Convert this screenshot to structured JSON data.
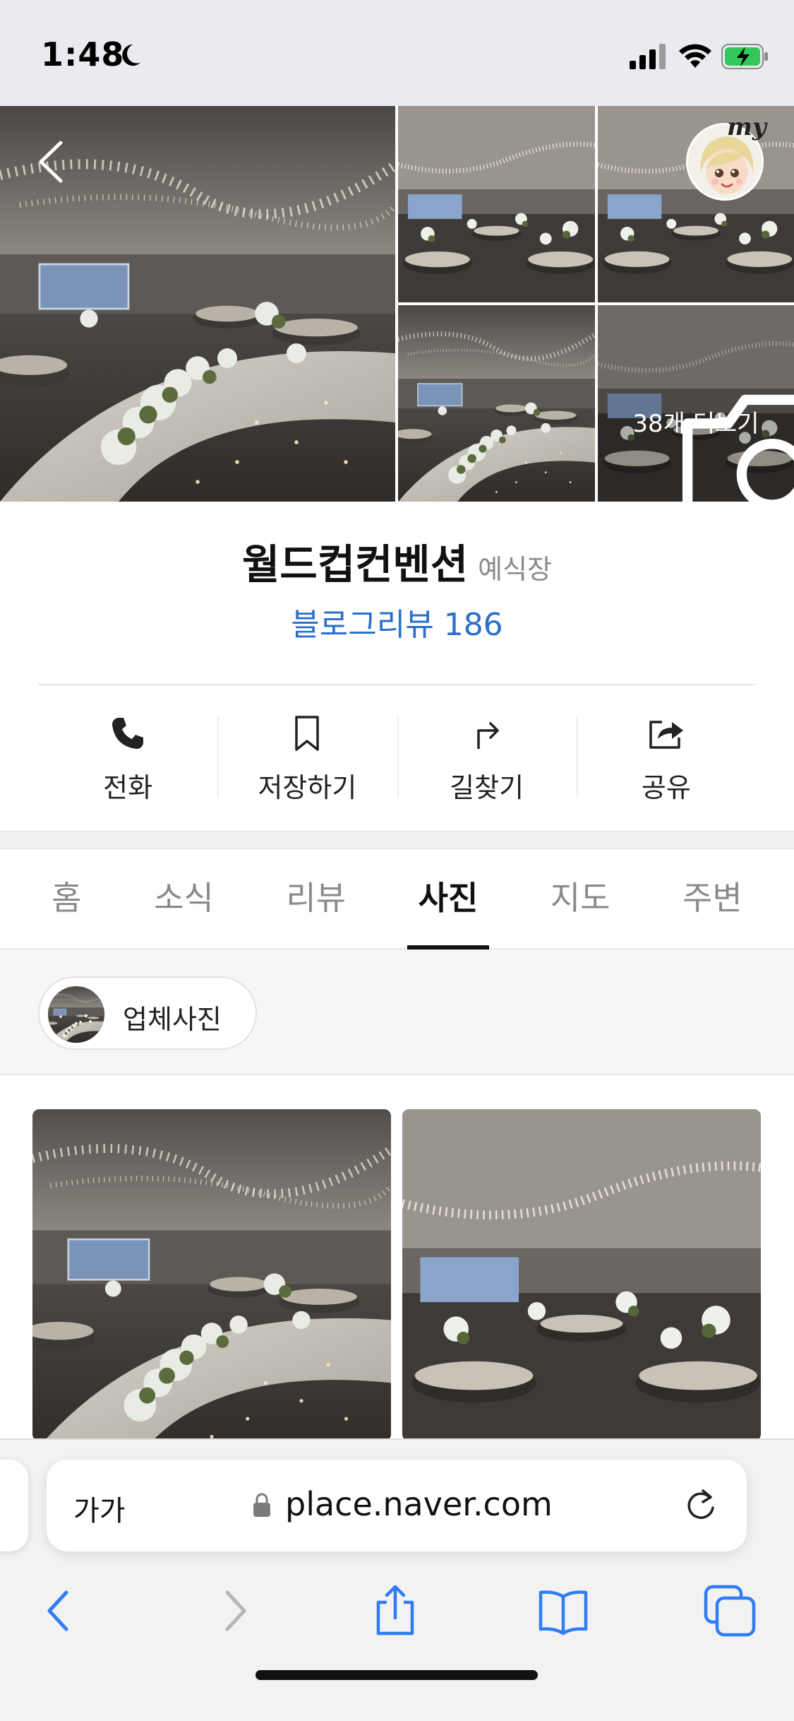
{
  "status_bar": {
    "time": "1:48"
  },
  "gallery": {
    "more_label": "38개 더보기"
  },
  "place": {
    "name": "월드컵컨벤션",
    "category": "예식장",
    "blog_review": "블로그리뷰 186"
  },
  "actions": [
    {
      "label": "전화",
      "icon": "phone-icon"
    },
    {
      "label": "저장하기",
      "icon": "bookmark-icon"
    },
    {
      "label": "길찾기",
      "icon": "directions-icon"
    },
    {
      "label": "공유",
      "icon": "share-icon"
    }
  ],
  "tabs": [
    {
      "label": "홈",
      "active": false
    },
    {
      "label": "소식",
      "active": false
    },
    {
      "label": "리뷰",
      "active": false
    },
    {
      "label": "사진",
      "active": true
    },
    {
      "label": "지도",
      "active": false
    },
    {
      "label": "주변",
      "active": false
    }
  ],
  "filter": {
    "chip_label": "업체사진"
  },
  "browser": {
    "text_size_label": "가가",
    "url": "place.naver.com"
  },
  "colors": {
    "link_blue": "#2a6fc9",
    "active_tab": "#111111",
    "inactive_tab": "#8a8a8a",
    "status_bar_bg": "#e9ebef",
    "battery_green": "#34c759",
    "browser_blue": "#2f7cf6"
  }
}
